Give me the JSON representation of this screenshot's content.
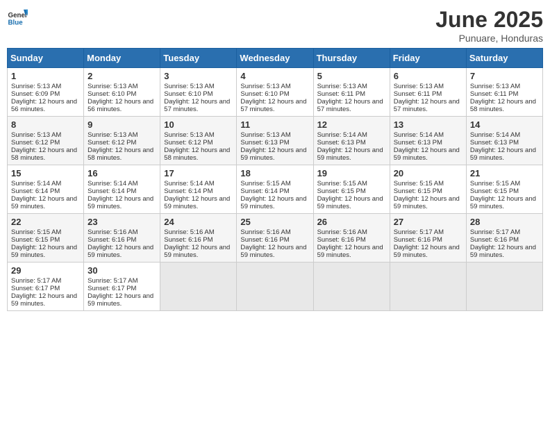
{
  "logo": {
    "general": "General",
    "blue": "Blue"
  },
  "title": {
    "month": "June 2025",
    "location": "Punuare, Honduras"
  },
  "weekdays": [
    "Sunday",
    "Monday",
    "Tuesday",
    "Wednesday",
    "Thursday",
    "Friday",
    "Saturday"
  ],
  "weeks": [
    [
      {
        "day": "1",
        "sunrise": "Sunrise: 5:13 AM",
        "sunset": "Sunset: 6:09 PM",
        "daylight": "Daylight: 12 hours and 56 minutes."
      },
      {
        "day": "2",
        "sunrise": "Sunrise: 5:13 AM",
        "sunset": "Sunset: 6:10 PM",
        "daylight": "Daylight: 12 hours and 56 minutes."
      },
      {
        "day": "3",
        "sunrise": "Sunrise: 5:13 AM",
        "sunset": "Sunset: 6:10 PM",
        "daylight": "Daylight: 12 hours and 57 minutes."
      },
      {
        "day": "4",
        "sunrise": "Sunrise: 5:13 AM",
        "sunset": "Sunset: 6:10 PM",
        "daylight": "Daylight: 12 hours and 57 minutes."
      },
      {
        "day": "5",
        "sunrise": "Sunrise: 5:13 AM",
        "sunset": "Sunset: 6:11 PM",
        "daylight": "Daylight: 12 hours and 57 minutes."
      },
      {
        "day": "6",
        "sunrise": "Sunrise: 5:13 AM",
        "sunset": "Sunset: 6:11 PM",
        "daylight": "Daylight: 12 hours and 57 minutes."
      },
      {
        "day": "7",
        "sunrise": "Sunrise: 5:13 AM",
        "sunset": "Sunset: 6:11 PM",
        "daylight": "Daylight: 12 hours and 58 minutes."
      }
    ],
    [
      {
        "day": "8",
        "sunrise": "Sunrise: 5:13 AM",
        "sunset": "Sunset: 6:12 PM",
        "daylight": "Daylight: 12 hours and 58 minutes."
      },
      {
        "day": "9",
        "sunrise": "Sunrise: 5:13 AM",
        "sunset": "Sunset: 6:12 PM",
        "daylight": "Daylight: 12 hours and 58 minutes."
      },
      {
        "day": "10",
        "sunrise": "Sunrise: 5:13 AM",
        "sunset": "Sunset: 6:12 PM",
        "daylight": "Daylight: 12 hours and 58 minutes."
      },
      {
        "day": "11",
        "sunrise": "Sunrise: 5:13 AM",
        "sunset": "Sunset: 6:13 PM",
        "daylight": "Daylight: 12 hours and 59 minutes."
      },
      {
        "day": "12",
        "sunrise": "Sunrise: 5:14 AM",
        "sunset": "Sunset: 6:13 PM",
        "daylight": "Daylight: 12 hours and 59 minutes."
      },
      {
        "day": "13",
        "sunrise": "Sunrise: 5:14 AM",
        "sunset": "Sunset: 6:13 PM",
        "daylight": "Daylight: 12 hours and 59 minutes."
      },
      {
        "day": "14",
        "sunrise": "Sunrise: 5:14 AM",
        "sunset": "Sunset: 6:13 PM",
        "daylight": "Daylight: 12 hours and 59 minutes."
      }
    ],
    [
      {
        "day": "15",
        "sunrise": "Sunrise: 5:14 AM",
        "sunset": "Sunset: 6:14 PM",
        "daylight": "Daylight: 12 hours and 59 minutes."
      },
      {
        "day": "16",
        "sunrise": "Sunrise: 5:14 AM",
        "sunset": "Sunset: 6:14 PM",
        "daylight": "Daylight: 12 hours and 59 minutes."
      },
      {
        "day": "17",
        "sunrise": "Sunrise: 5:14 AM",
        "sunset": "Sunset: 6:14 PM",
        "daylight": "Daylight: 12 hours and 59 minutes."
      },
      {
        "day": "18",
        "sunrise": "Sunrise: 5:15 AM",
        "sunset": "Sunset: 6:14 PM",
        "daylight": "Daylight: 12 hours and 59 minutes."
      },
      {
        "day": "19",
        "sunrise": "Sunrise: 5:15 AM",
        "sunset": "Sunset: 6:15 PM",
        "daylight": "Daylight: 12 hours and 59 minutes."
      },
      {
        "day": "20",
        "sunrise": "Sunrise: 5:15 AM",
        "sunset": "Sunset: 6:15 PM",
        "daylight": "Daylight: 12 hours and 59 minutes."
      },
      {
        "day": "21",
        "sunrise": "Sunrise: 5:15 AM",
        "sunset": "Sunset: 6:15 PM",
        "daylight": "Daylight: 12 hours and 59 minutes."
      }
    ],
    [
      {
        "day": "22",
        "sunrise": "Sunrise: 5:15 AM",
        "sunset": "Sunset: 6:15 PM",
        "daylight": "Daylight: 12 hours and 59 minutes."
      },
      {
        "day": "23",
        "sunrise": "Sunrise: 5:16 AM",
        "sunset": "Sunset: 6:16 PM",
        "daylight": "Daylight: 12 hours and 59 minutes."
      },
      {
        "day": "24",
        "sunrise": "Sunrise: 5:16 AM",
        "sunset": "Sunset: 6:16 PM",
        "daylight": "Daylight: 12 hours and 59 minutes."
      },
      {
        "day": "25",
        "sunrise": "Sunrise: 5:16 AM",
        "sunset": "Sunset: 6:16 PM",
        "daylight": "Daylight: 12 hours and 59 minutes."
      },
      {
        "day": "26",
        "sunrise": "Sunrise: 5:16 AM",
        "sunset": "Sunset: 6:16 PM",
        "daylight": "Daylight: 12 hours and 59 minutes."
      },
      {
        "day": "27",
        "sunrise": "Sunrise: 5:17 AM",
        "sunset": "Sunset: 6:16 PM",
        "daylight": "Daylight: 12 hours and 59 minutes."
      },
      {
        "day": "28",
        "sunrise": "Sunrise: 5:17 AM",
        "sunset": "Sunset: 6:16 PM",
        "daylight": "Daylight: 12 hours and 59 minutes."
      }
    ],
    [
      {
        "day": "29",
        "sunrise": "Sunrise: 5:17 AM",
        "sunset": "Sunset: 6:17 PM",
        "daylight": "Daylight: 12 hours and 59 minutes."
      },
      {
        "day": "30",
        "sunrise": "Sunrise: 5:17 AM",
        "sunset": "Sunset: 6:17 PM",
        "daylight": "Daylight: 12 hours and 59 minutes."
      },
      null,
      null,
      null,
      null,
      null
    ]
  ]
}
